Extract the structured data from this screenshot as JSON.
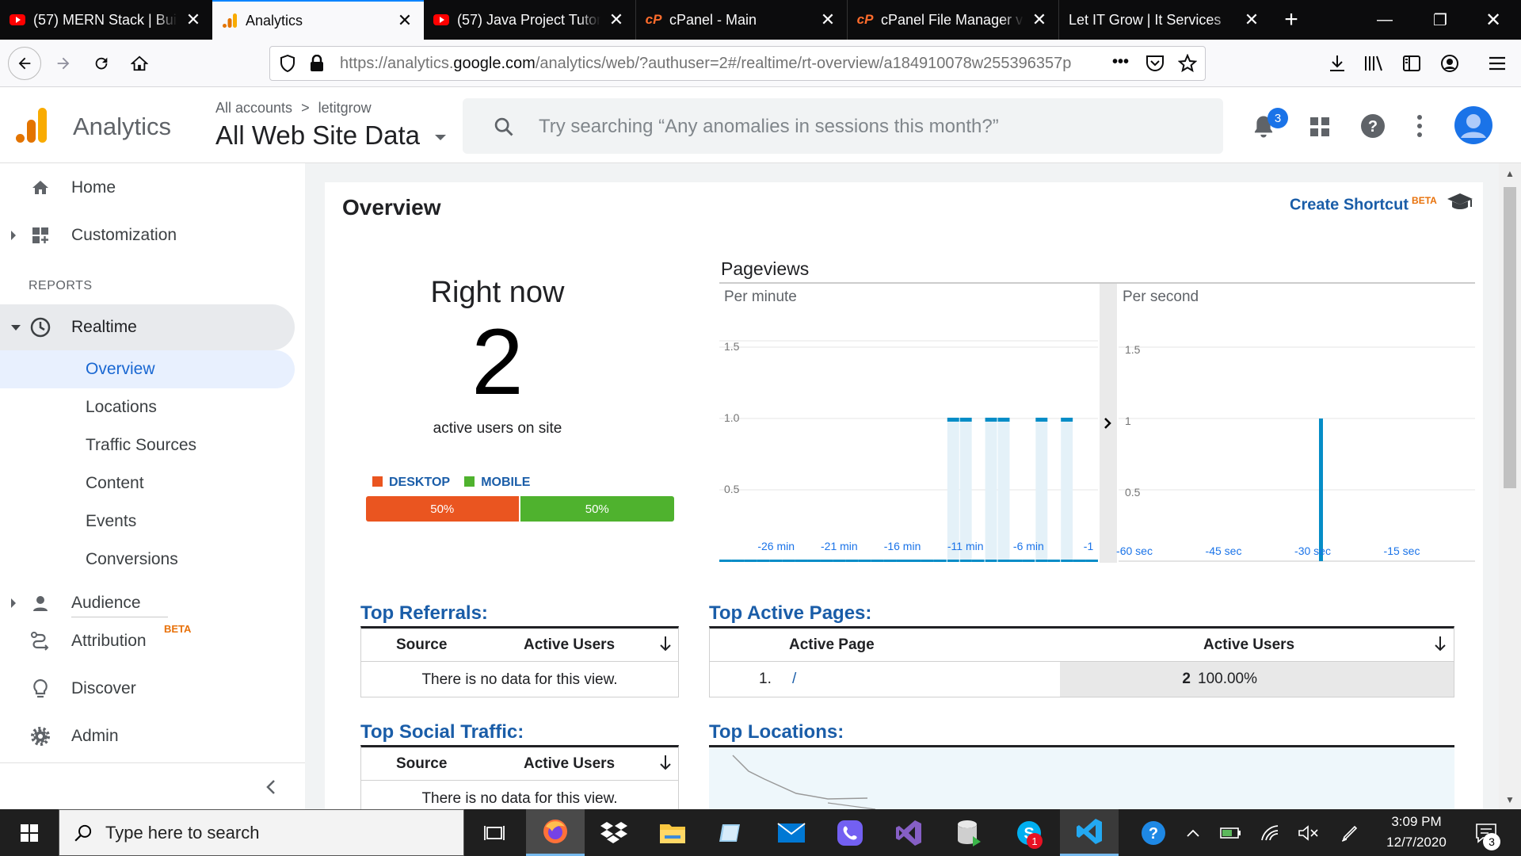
{
  "browser": {
    "tabs": [
      {
        "title": "(57) MERN Stack | Buil",
        "icon": "youtube-icon"
      },
      {
        "title": "Analytics",
        "icon": "analytics-icon",
        "active": true
      },
      {
        "title": "(57) Java Project Tutor",
        "icon": "youtube-icon"
      },
      {
        "title": "cPanel - Main",
        "icon": "cpanel-icon"
      },
      {
        "title": "cPanel File Manager v",
        "icon": "cpanel-icon"
      },
      {
        "title": "Let IT Grow | It Services",
        "icon": "none"
      }
    ],
    "new_tab": "+",
    "url_pre": "https://analytics.",
    "url_domain": "google.com",
    "url_post": "/analytics/web/?authuser=2#/realtime/rt-overview/a184910078w255396357p",
    "url_more": "•••"
  },
  "ga": {
    "product": "Analytics",
    "breadcrumb_accounts": "All accounts",
    "breadcrumb_sep": ">",
    "breadcrumb_property": "letitgrow",
    "view": "All Web Site Data",
    "search_placeholder": "Try searching “Any anomalies in sessions this month?”",
    "notifications_count": "3"
  },
  "sidebar": {
    "home": "Home",
    "customization": "Customization",
    "reports_heading": "REPORTS",
    "realtime": "Realtime",
    "realtime_items": [
      "Overview",
      "Locations",
      "Traffic Sources",
      "Content",
      "Events",
      "Conversions"
    ],
    "audience": "Audience",
    "attribution": "Attribution",
    "attribution_badge": "BETA",
    "discover": "Discover",
    "admin": "Admin"
  },
  "overview": {
    "title": "Overview",
    "create_shortcut": "Create Shortcut",
    "shortcut_badge": "BETA",
    "right_now_label": "Right now",
    "active_users": "2",
    "active_users_caption": "active users on site",
    "devices": [
      {
        "name": "DESKTOP",
        "percent": 50,
        "percent_label": "50%",
        "color": "#ea5520"
      },
      {
        "name": "MOBILE",
        "percent": 50,
        "percent_label": "50%",
        "color": "#4fb22e"
      }
    ]
  },
  "chart_data": [
    {
      "type": "bar",
      "title": "Pageviews",
      "subtitle": "Per minute",
      "y_ticks": [
        "1.5",
        "1.0",
        "0.5"
      ],
      "ylim": [
        0,
        1.5
      ],
      "x_ticks": [
        "-26 min",
        "-21 min",
        "-16 min",
        "-11 min",
        "-6 min",
        "-1"
      ],
      "x": [
        -30,
        -29,
        -28,
        -27,
        -26,
        -25,
        -24,
        -23,
        -22,
        -21,
        -20,
        -19,
        -18,
        -17,
        -16,
        -15,
        -14,
        -13,
        -12,
        -11,
        -10,
        -9,
        -8,
        -7,
        -6,
        -5,
        -4,
        -3,
        -2,
        -1
      ],
      "values": [
        0,
        0,
        0,
        0,
        0,
        0,
        0,
        0,
        0,
        0,
        0,
        0,
        0,
        0,
        0,
        0,
        0,
        0,
        1,
        1,
        0,
        1,
        1,
        0,
        0,
        1,
        0,
        1,
        0,
        0
      ],
      "color": "#058dc7"
    },
    {
      "type": "bar",
      "subtitle": "Per second",
      "y_ticks": [
        "1.5",
        "1",
        "0.5"
      ],
      "ylim": [
        0,
        1.5
      ],
      "x_ticks": [
        "-60 sec",
        "-45 sec",
        "-30 sec",
        "-15 sec"
      ],
      "x": [
        -26
      ],
      "values": [
        1
      ],
      "x_range": [
        -60,
        0
      ],
      "color": "#058dc7"
    }
  ],
  "top_referrals": {
    "title": "Top Referrals:",
    "col_source": "Source",
    "col_users": "Active Users",
    "empty": "There is no data for this view."
  },
  "top_active_pages": {
    "title": "Top Active Pages:",
    "col_page": "Active Page",
    "col_users": "Active Users",
    "rows": [
      {
        "rank": "1.",
        "page": "/",
        "users": "2",
        "percent": "100.00%"
      }
    ]
  },
  "top_social": {
    "title": "Top Social Traffic:",
    "col_source": "Source",
    "col_users": "Active Users",
    "empty": "There is no data for this view."
  },
  "top_locations": {
    "title": "Top Locations:"
  },
  "taskbar": {
    "search_placeholder": "Type here to search",
    "time": "3:09 PM",
    "date": "12/7/2020",
    "skype_badge": "1",
    "notifications_badge": "3"
  }
}
